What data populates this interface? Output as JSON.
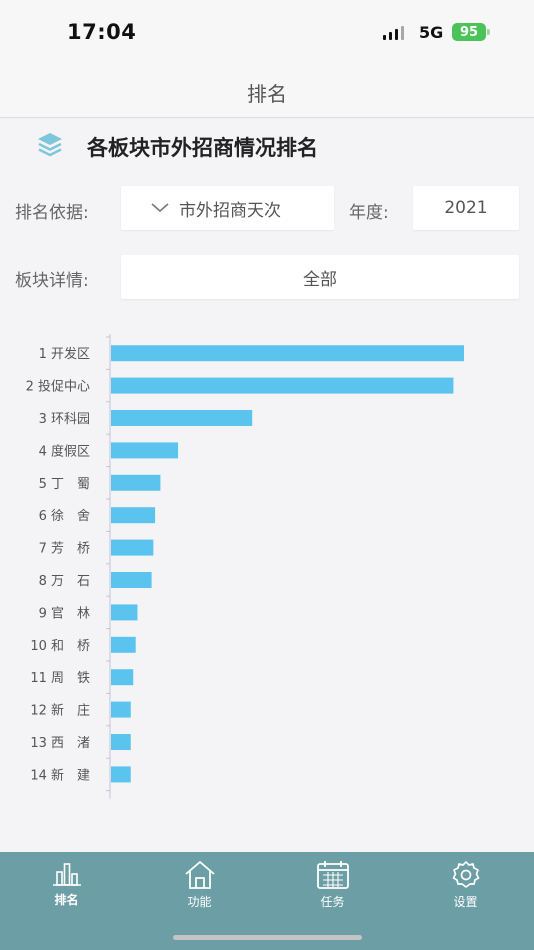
{
  "status_bar": {
    "time": "17:04",
    "network": "5G",
    "battery": "95"
  },
  "nav": {
    "title": "排名"
  },
  "section": {
    "title": "各板块市外招商情况排名",
    "icon": "layers-icon"
  },
  "filters": {
    "basis_label": "排名依据:",
    "basis_value": "市外招商天次",
    "year_label": "年度:",
    "year_value": "2021",
    "sector_label": "板块详情:",
    "sector_value": "全部"
  },
  "chart_data": {
    "type": "bar",
    "orientation": "horizontal",
    "bar_color": "#5bc4ee",
    "categories": [
      "1 开发区",
      "2 投促中心",
      "3 环科园",
      "4 度假区",
      "5 丁　蜀",
      "6 徐　舍",
      "7 芳　桥",
      "8 万　石",
      "9 官　林",
      "10 和　桥",
      "11 周　铁",
      "12 新　庄",
      "13 西　渚",
      "14 新　建"
    ],
    "values": [
      100,
      97,
      40,
      19,
      14,
      12.5,
      12,
      11.5,
      7.5,
      7,
      6.3,
      5.6,
      5.6,
      5.6
    ],
    "xlim": [
      0,
      100
    ]
  },
  "tabs": [
    {
      "label": "排名",
      "icon": "bar-chart-icon",
      "active": true
    },
    {
      "label": "功能",
      "icon": "home-icon",
      "active": false
    },
    {
      "label": "任务",
      "icon": "calendar-icon",
      "active": false
    },
    {
      "label": "设置",
      "icon": "gear-icon",
      "active": false
    }
  ],
  "colors": {
    "tab_bar": "#6c9ea6",
    "accent": "#5bc4ee"
  }
}
